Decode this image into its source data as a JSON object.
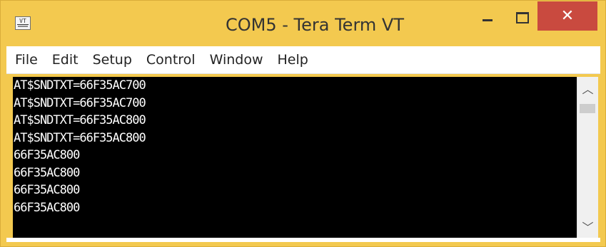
{
  "window": {
    "title": "COM5 - Tera Term VT",
    "icon_glyph": "VT",
    "close_glyph": "✕"
  },
  "menu": {
    "items": [
      "File",
      "Edit",
      "Setup",
      "Control",
      "Window",
      "Help"
    ]
  },
  "terminal": {
    "lines": [
      "AT$SNDTXT=66F35AC700",
      "AT$SNDTXT=66F35AC700",
      "AT$SNDTXT=66F35AC800",
      "AT$SNDTXT=66F35AC800",
      "66F35AC800",
      "66F35AC800",
      "66F35AC800",
      "66F35AC800"
    ]
  },
  "scrollbar": {
    "up_glyph": "︿",
    "down_glyph": "﹀"
  },
  "colors": {
    "frame": "#f3c94f",
    "close_button": "#c94a3f",
    "terminal_bg": "#000000",
    "terminal_fg": "#ffffff"
  }
}
